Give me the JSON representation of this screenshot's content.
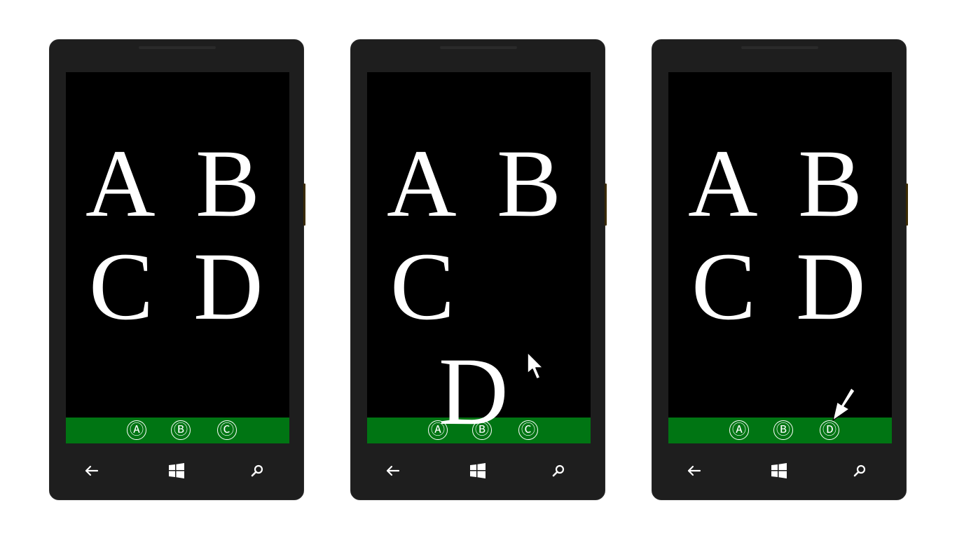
{
  "screens": [
    {
      "id": "step-1",
      "letters": [
        "A",
        "B",
        "C",
        "D"
      ],
      "appbar_items": [
        "Ⓐ",
        "Ⓑ",
        "Ⓒ"
      ]
    },
    {
      "id": "step-2",
      "letters": [
        "A",
        "B",
        "C",
        ""
      ],
      "dragging_letter": "D",
      "appbar_items": [
        "Ⓐ",
        "Ⓑ",
        "Ⓒ"
      ]
    },
    {
      "id": "step-3",
      "letters": [
        "A",
        "B",
        "C",
        "D"
      ],
      "appbar_items": [
        "Ⓐ",
        "Ⓑ",
        "Ⓓ"
      ]
    }
  ],
  "colors": {
    "appbar": "#007513",
    "phone_body": "#1e1e1e",
    "screen": "#000000",
    "text": "#ffffff"
  },
  "icons": {
    "back": "back-arrow-icon",
    "start": "windows-logo-icon",
    "search": "search-icon"
  }
}
